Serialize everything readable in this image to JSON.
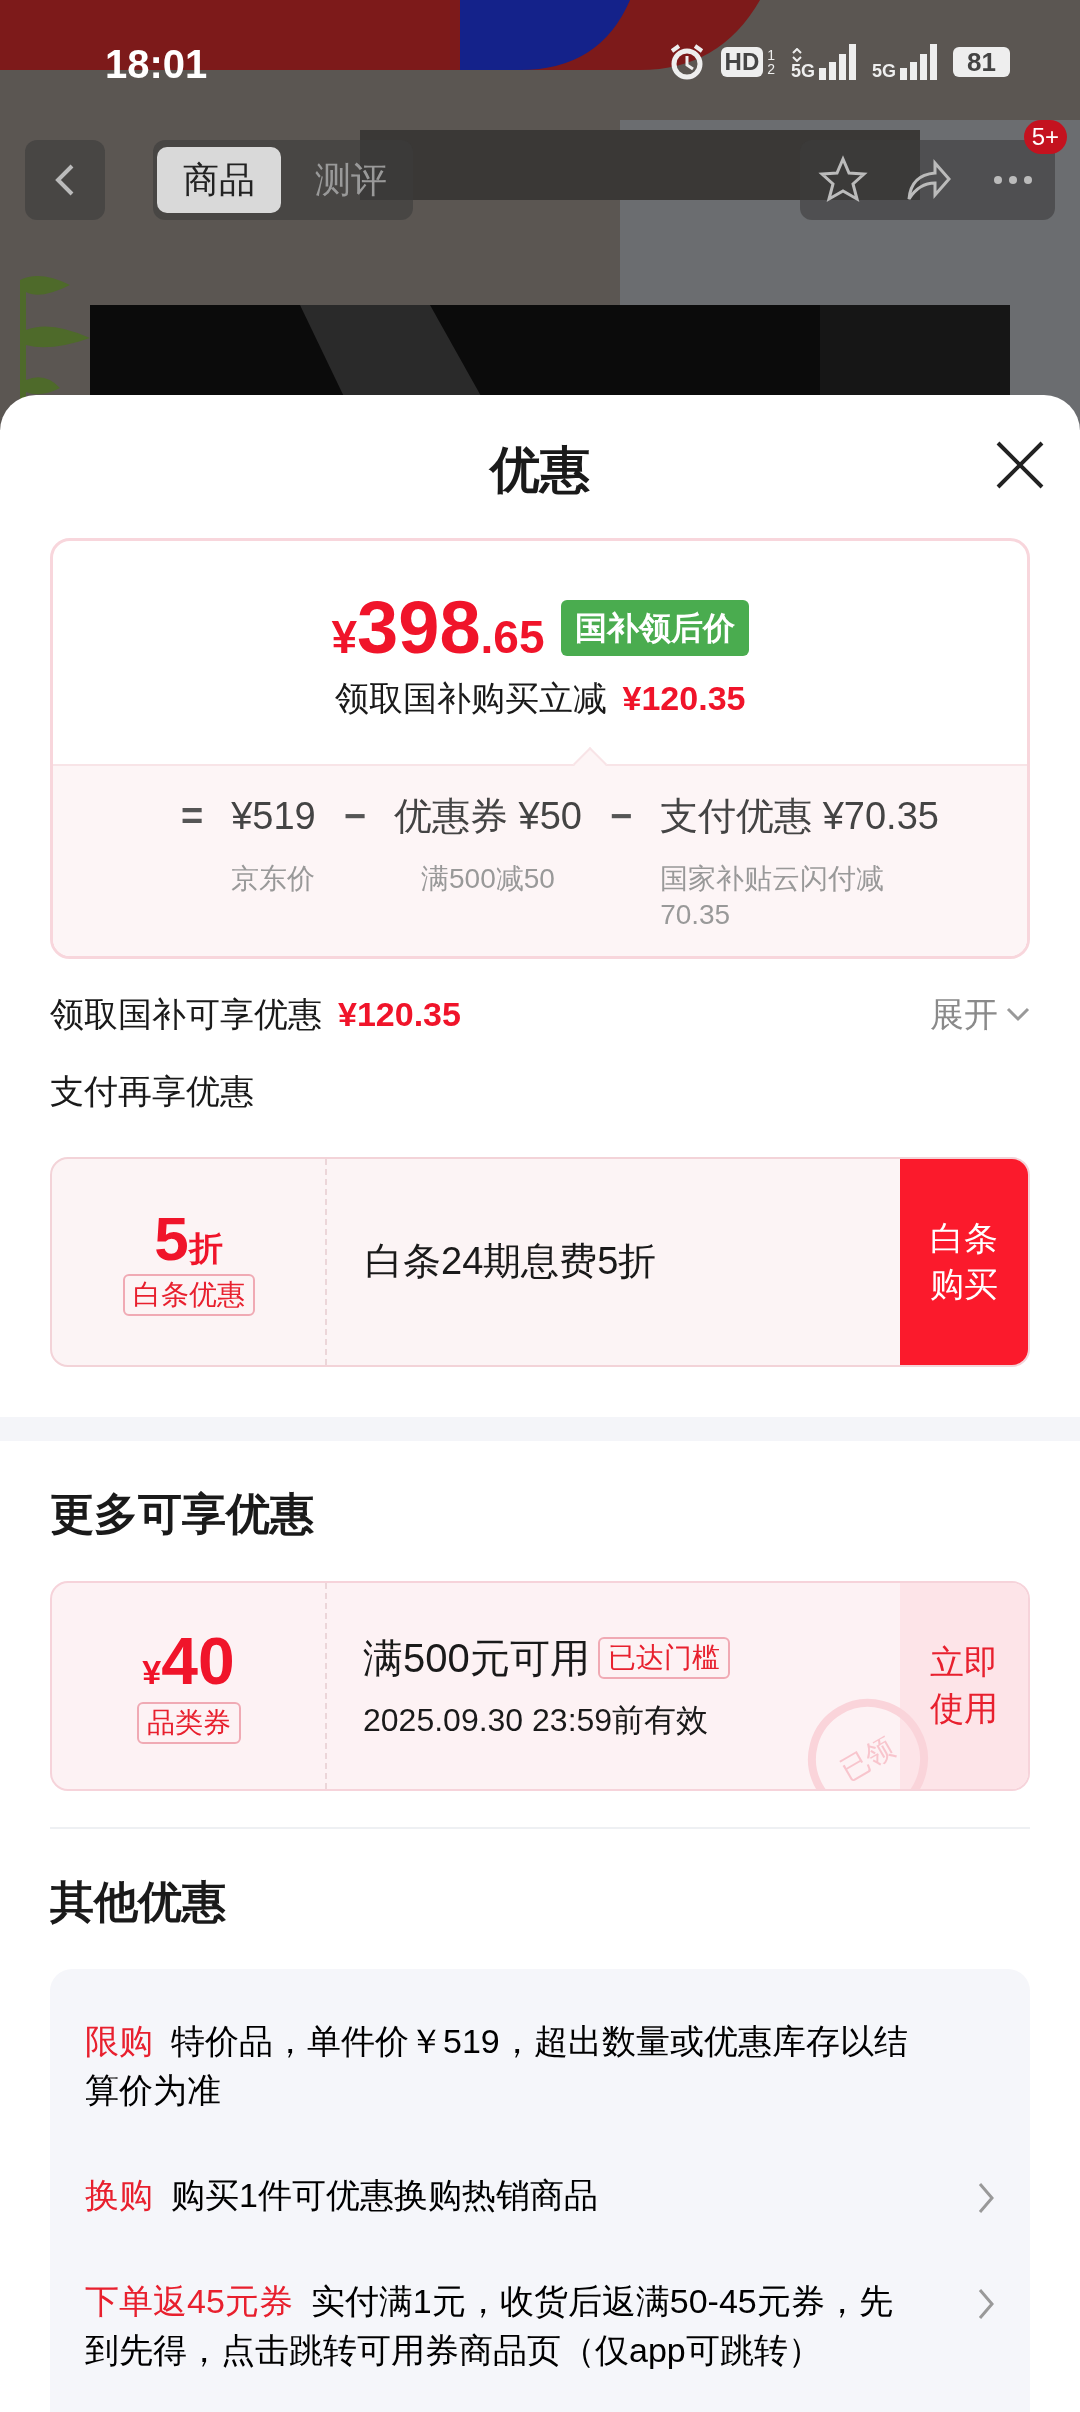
{
  "status_bar": {
    "time": "18:01",
    "hd_label": "HD",
    "sim_digits": [
      "1",
      "2"
    ],
    "signals": [
      {
        "label": "5G",
        "data_arrows": true
      },
      {
        "label": "5G",
        "data_arrows": false
      }
    ],
    "battery": "81"
  },
  "nav": {
    "tabs": [
      {
        "label": "商品",
        "selected": true
      },
      {
        "label": "测评",
        "selected": false
      }
    ],
    "badge": "5+"
  },
  "sheet": {
    "title": "优惠"
  },
  "price_card": {
    "currency": "¥",
    "price_int": "398",
    "price_dec": ".65",
    "price_tag": "国补领后价",
    "saving_label": "领取国补购买立减",
    "saving_amount": "¥120.35",
    "formula": [
      {
        "kind": "op",
        "text": "="
      },
      {
        "kind": "term",
        "value": "¥519",
        "note": "京东价"
      },
      {
        "kind": "op",
        "text": "−"
      },
      {
        "kind": "term",
        "value": "优惠券 ¥50",
        "note": "满500减50"
      },
      {
        "kind": "op",
        "text": "−"
      },
      {
        "kind": "term",
        "value": "支付优惠 ¥70.35",
        "note": "国家补贴云闪付减70.35"
      }
    ]
  },
  "subsidy_row": {
    "label": "领取国补可享优惠",
    "amount": "¥120.35",
    "toggle": "展开",
    "expanded": false
  },
  "pay_section": {
    "title": "支付再享优惠",
    "offer": {
      "big": "5",
      "unit": "折",
      "tag": "白条优惠",
      "text": "白条24期息费5折",
      "button": "白条购买"
    }
  },
  "more_section": {
    "title": "更多可享优惠",
    "coupon": {
      "currency": "¥",
      "amount": "40",
      "tag": "品类券",
      "condition": "满500元可用",
      "threshold_tag": "已达门槛",
      "validity": "2025.09.30 23:59前有效",
      "button": "立即使用",
      "stamp": "已领"
    }
  },
  "other_section": {
    "title": "其他优惠",
    "rows": [
      {
        "tag": "限购",
        "text": "特价品，单件价￥519，超出数量或优惠库存以结算价为准",
        "has_arrow": false
      },
      {
        "tag": "换购",
        "text": "购买1件可优惠换购热销商品",
        "has_arrow": true
      },
      {
        "tag": "下单返45元券",
        "text": "实付满1元，收货后返满50-45元券，先到先得，点击跳转可用券商品页（仅app可跳转）",
        "has_arrow": true
      }
    ]
  }
}
